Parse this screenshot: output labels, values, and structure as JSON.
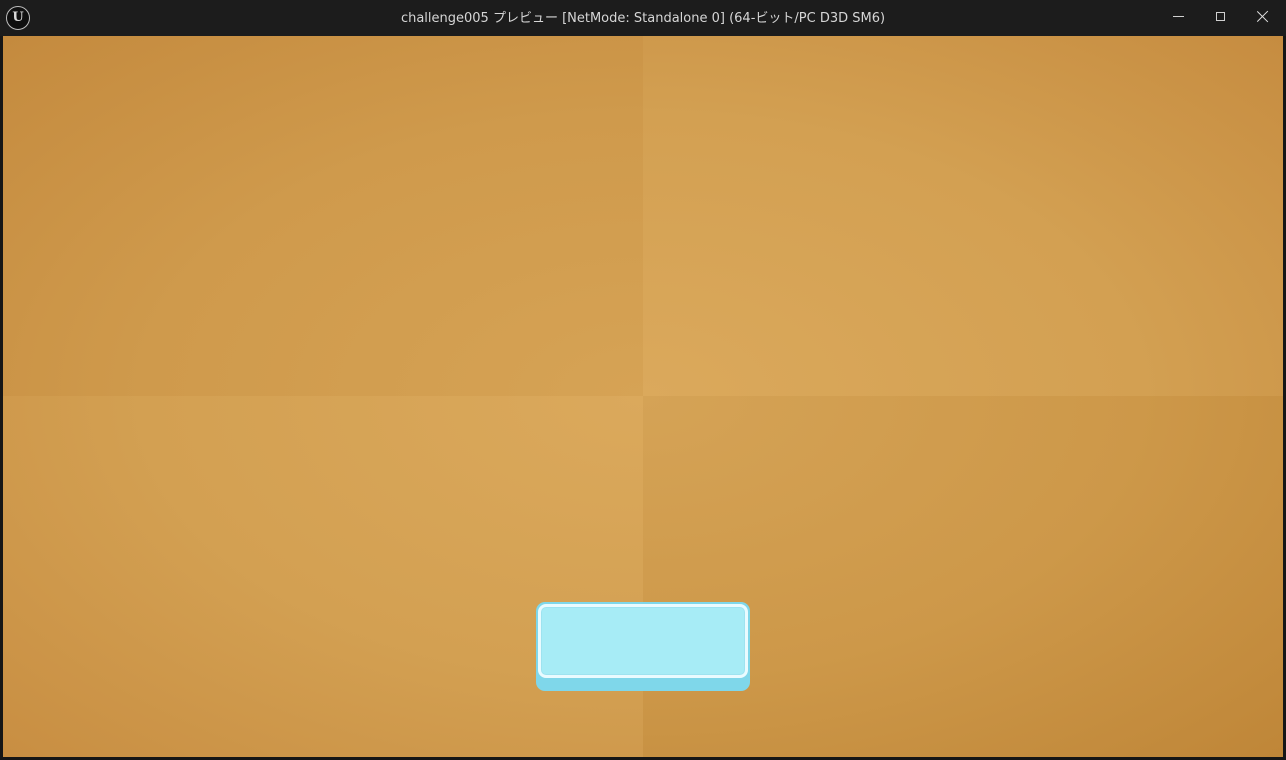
{
  "window": {
    "title": "challenge005 プレビュー [NetMode: Standalone 0]  (64-ビット/PC D3D SM6)",
    "logo_letter": "U"
  },
  "viewport": {
    "background_color": "#d29e52",
    "button": {
      "label": "",
      "fill_color": "#a7ecf6",
      "border_color": "#e9fbff",
      "shadow_color": "#7fd7ea"
    }
  }
}
